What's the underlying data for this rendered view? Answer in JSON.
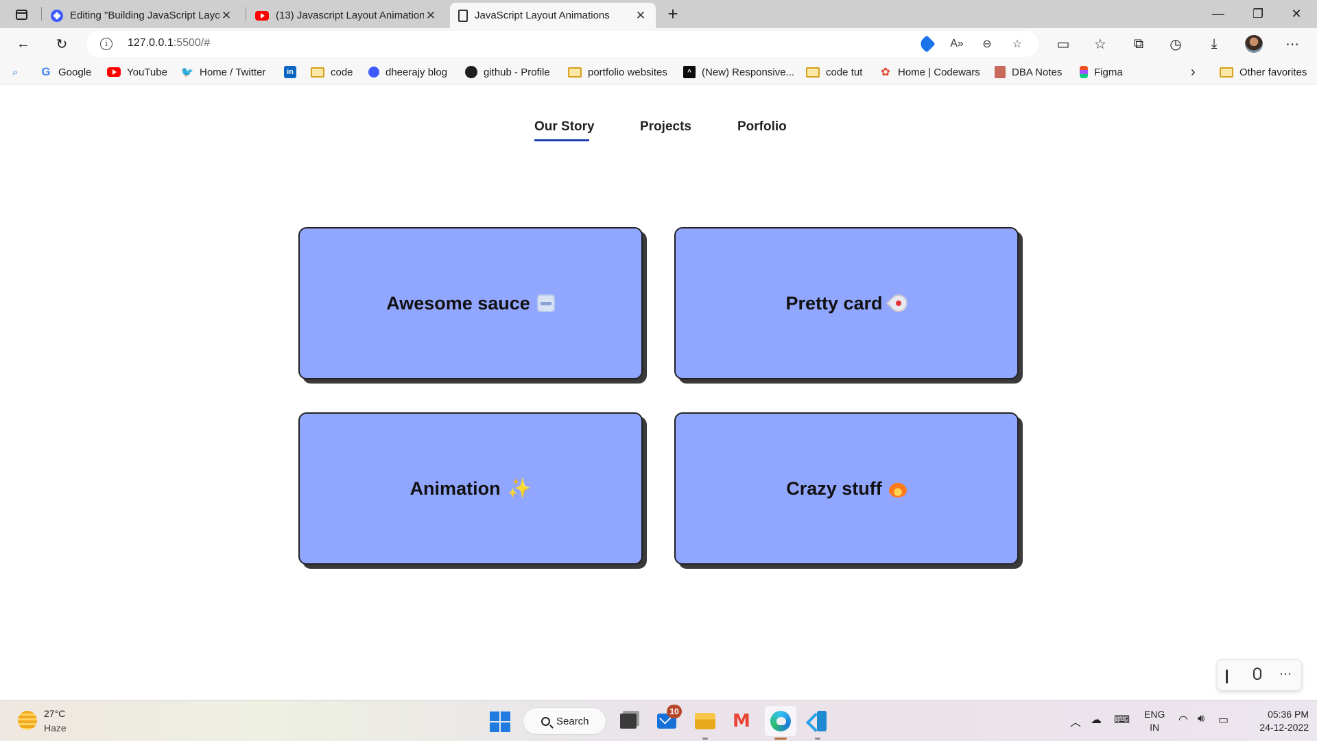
{
  "browser": {
    "tabs": [
      {
        "title": "Editing \"Building JavaScript Layo",
        "icon": "edit-icon",
        "active": false
      },
      {
        "title": "(13) Javascript Layout Animation",
        "icon": "youtube-icon",
        "active": false
      },
      {
        "title": "JavaScript Layout Animations",
        "icon": "page-icon",
        "active": true
      }
    ],
    "new_tab_label": "+",
    "window_controls": {
      "minimize": "—",
      "restore": "❐",
      "close": "✕"
    },
    "address": {
      "host": "127.0.0.1",
      "rest": ":5500/#"
    },
    "favorites": [
      {
        "label": "Google",
        "icon": "google-icon"
      },
      {
        "label": "YouTube",
        "icon": "youtube-icon"
      },
      {
        "label": "Home / Twitter",
        "icon": "twitter-icon"
      },
      {
        "label": "",
        "icon": "linkedin-icon"
      },
      {
        "label": "code",
        "icon": "folder-icon"
      },
      {
        "label": "dheerajy blog",
        "icon": "blog-icon"
      },
      {
        "label": "github - Profile",
        "icon": "github-icon"
      },
      {
        "label": "portfolio websites",
        "icon": "folder-icon"
      },
      {
        "label": "(New) Responsive...",
        "icon": "frontend-mentor-icon"
      },
      {
        "label": "code tut",
        "icon": "folder-icon"
      },
      {
        "label": "Home | Codewars",
        "icon": "codewars-icon"
      },
      {
        "label": "DBA Notes",
        "icon": "notes-icon"
      },
      {
        "label": "Figma",
        "icon": "figma-icon"
      }
    ],
    "other_favorites": "Other favorites"
  },
  "page": {
    "nav": [
      {
        "label": "Our Story",
        "active": true
      },
      {
        "label": "Projects",
        "active": false
      },
      {
        "label": "Porfolio",
        "active": false
      }
    ],
    "cards": [
      {
        "title": "Awesome sauce",
        "emoji": "jar-emoji"
      },
      {
        "title": "Pretty card",
        "emoji": "rocket-emoji"
      },
      {
        "title": "Animation",
        "emoji": "sparkles-emoji"
      },
      {
        "title": "Crazy stuff",
        "emoji": "fire-emoji"
      }
    ],
    "card_color": "#91a6ff",
    "accent_color": "#1e40af"
  },
  "taskbar": {
    "weather": {
      "temp": "27°C",
      "desc": "Haze"
    },
    "search_label": "Search",
    "mail_badge": "10",
    "language": {
      "line1": "ENG",
      "line2": "IN"
    },
    "clock": {
      "time": "05:36 PM",
      "date": "24-12-2022"
    }
  }
}
